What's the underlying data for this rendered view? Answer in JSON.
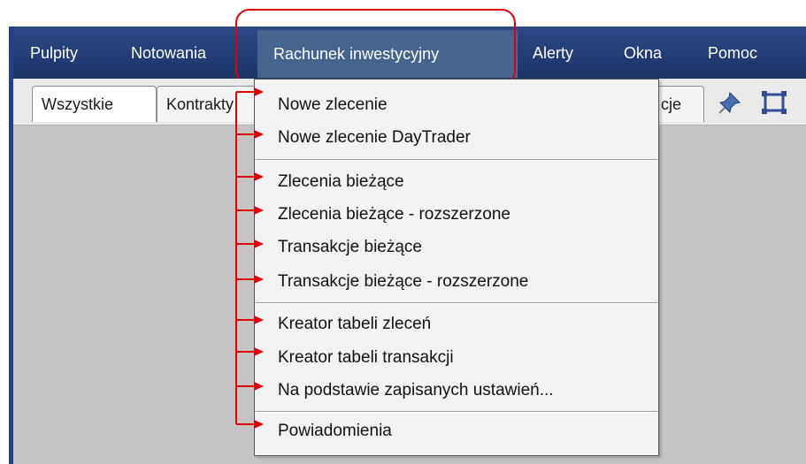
{
  "menubar": {
    "items": [
      {
        "label": "Pulpity"
      },
      {
        "label": "Notowania"
      },
      {
        "label": "Rachunek inwestycyjny"
      },
      {
        "label": "Alerty"
      },
      {
        "label": "Okna"
      },
      {
        "label": "Pomoc"
      }
    ],
    "active_index": 2
  },
  "tabs": [
    {
      "label": "Wszystkie"
    },
    {
      "label": "Kontrakty"
    },
    {
      "label": "cje"
    }
  ],
  "toolbar": {
    "pin_icon": "pin-icon",
    "maximize_icon": "maximize-icon"
  },
  "dropdown": {
    "items": [
      {
        "label": "Nowe zlecenie"
      },
      {
        "label": "Nowe zlecenie DayTrader"
      },
      {
        "label": "Zlecenia bieżące"
      },
      {
        "label": "Zlecenia bieżące - rozszerzone"
      },
      {
        "label": "Transakcje bieżące"
      },
      {
        "label": "Transakcje bieżące - rozszerzone"
      },
      {
        "label": "Kreator tabeli zleceń"
      },
      {
        "label": "Kreator tabeli transakcji"
      },
      {
        "label": "Na podstawie zapisanych ustawień..."
      },
      {
        "label": "Powiadomienia"
      }
    ]
  },
  "colors": {
    "menubar": "#1f3a70",
    "active_menu": "#44658e",
    "annotation": "#e0000a",
    "workspace": "#c4c4c4"
  }
}
